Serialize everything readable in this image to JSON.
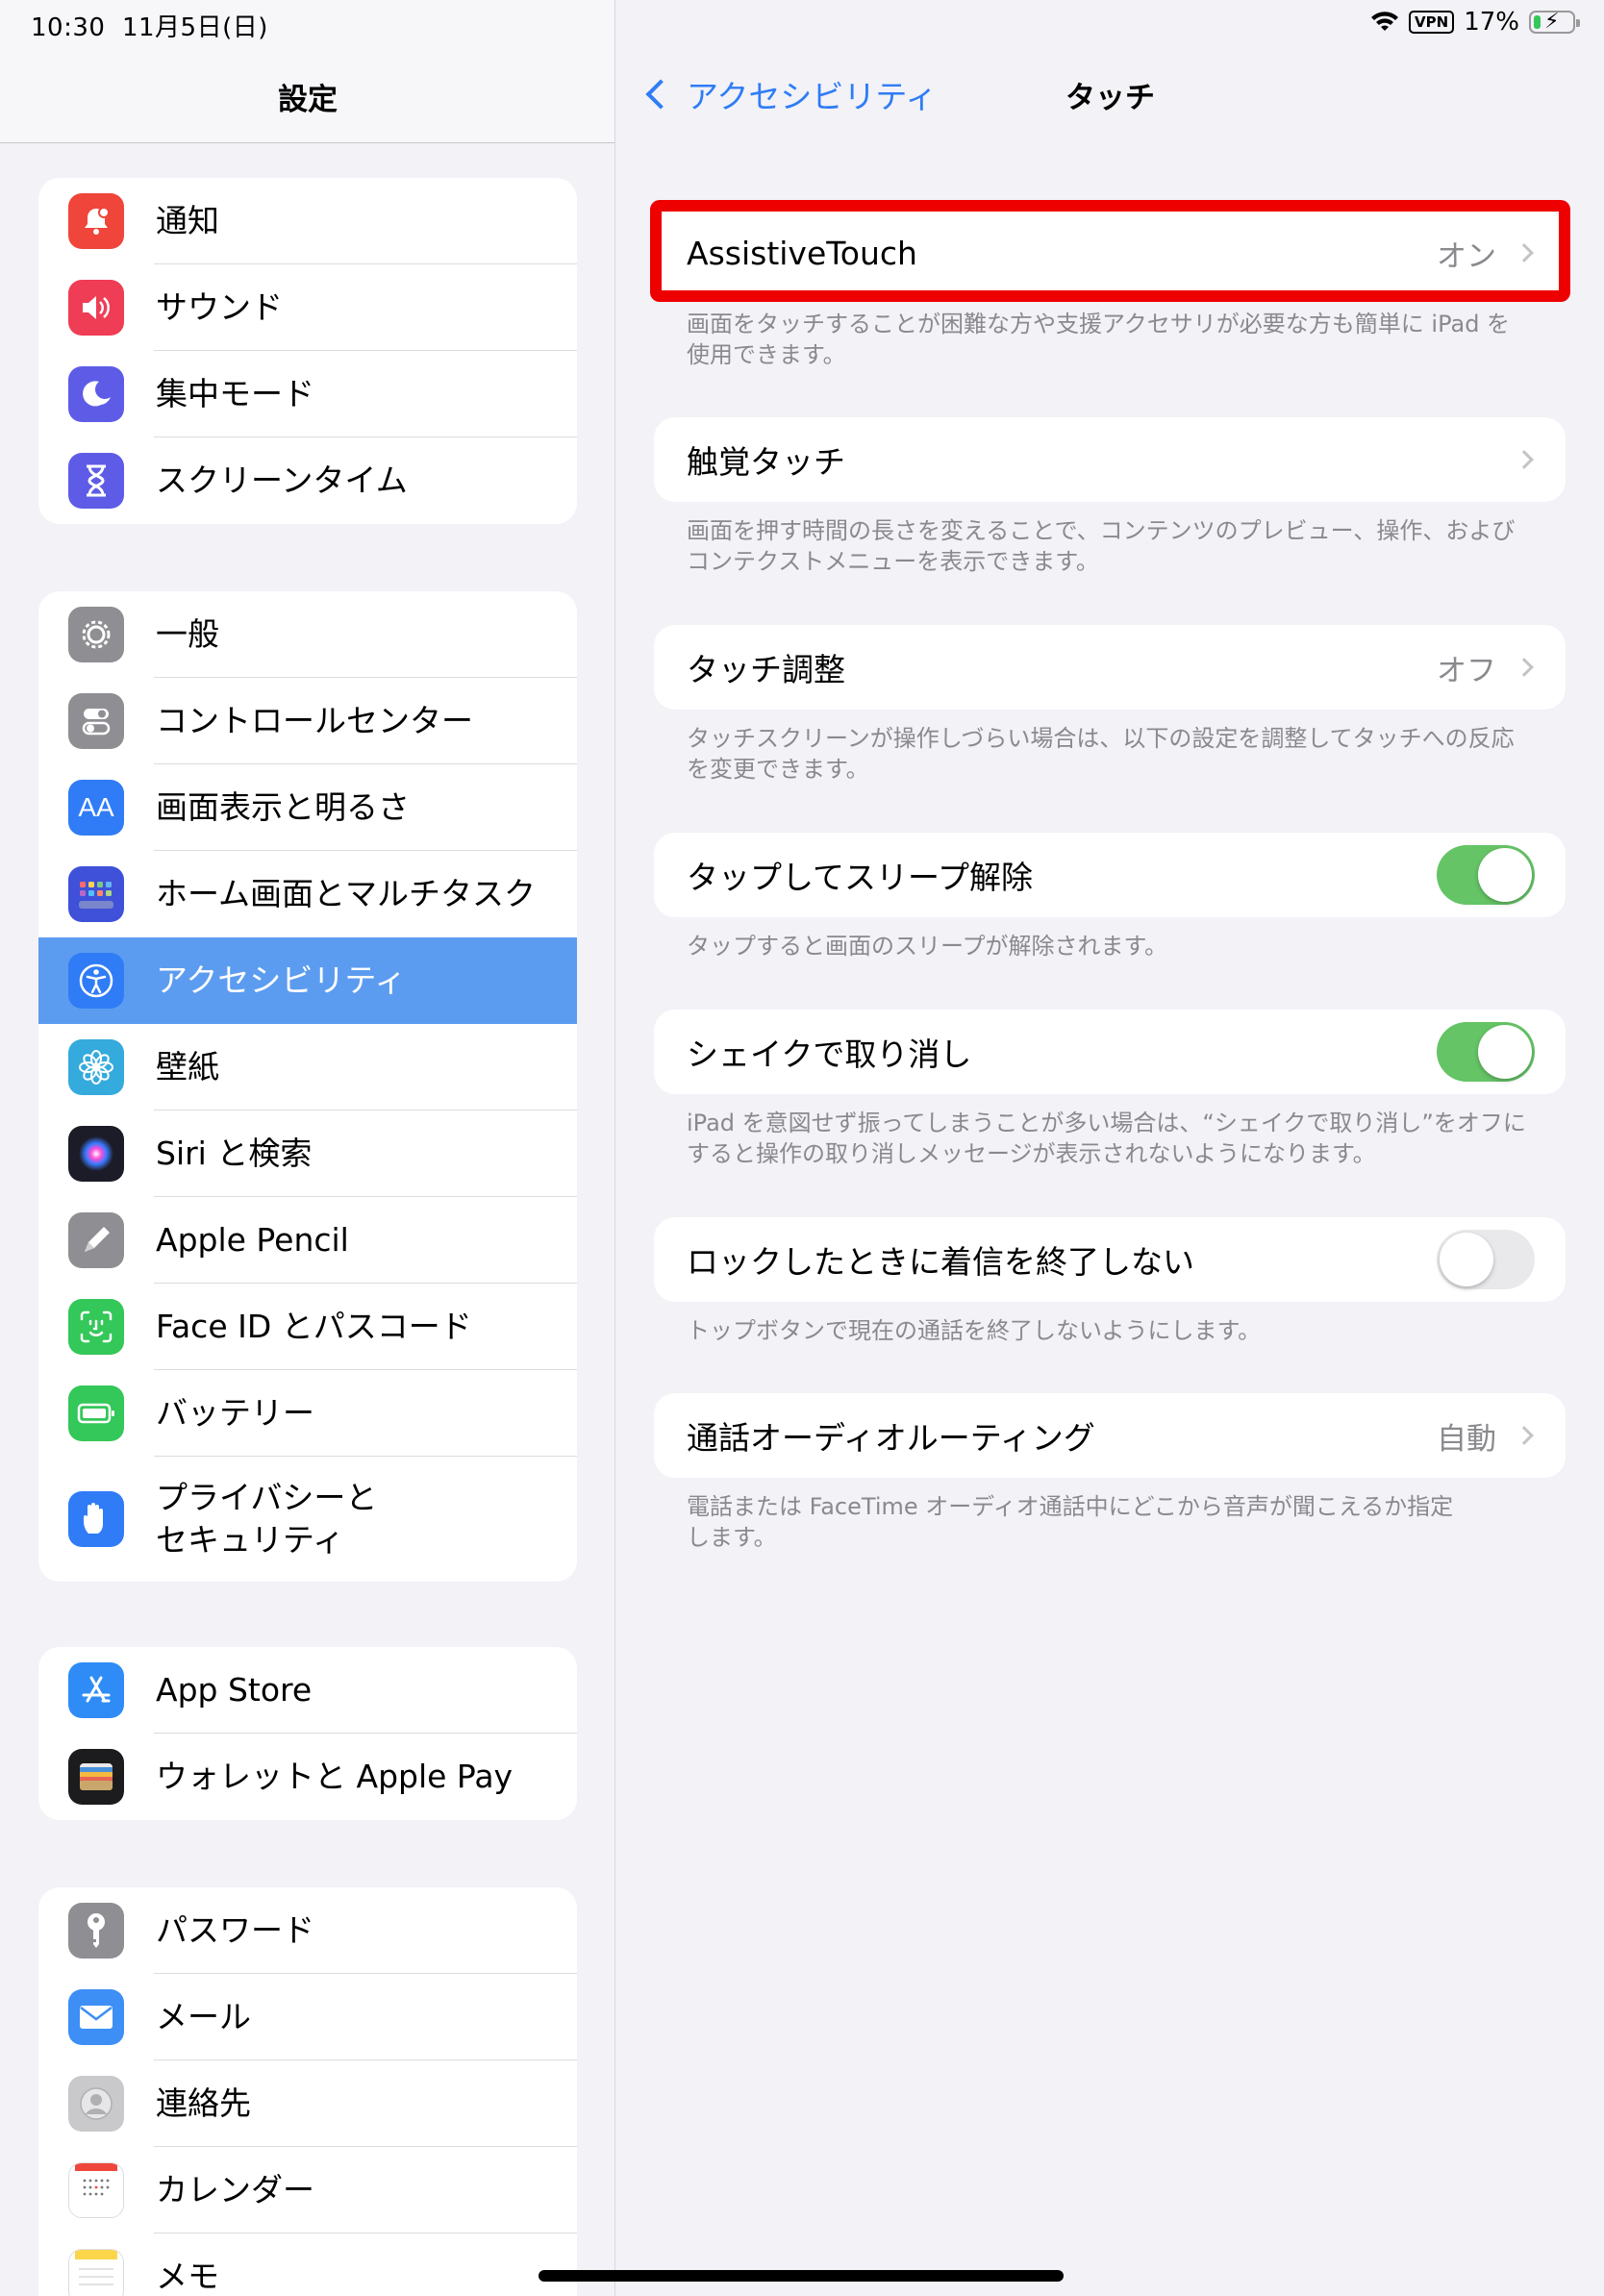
{
  "status": {
    "time": "10:30",
    "date": "11月5日(日)",
    "vpn": "VPN",
    "battery": "17%",
    "battery_level": 0.17
  },
  "sidebar": {
    "title": "設定",
    "groups": [
      [
        {
          "label": "通知",
          "icon": "bell-icon",
          "color": "#f0453a"
        },
        {
          "label": "サウンド",
          "icon": "speaker-icon",
          "color": "#ef3d55"
        },
        {
          "label": "集中モード",
          "icon": "moon-icon",
          "color": "#5e5ce6"
        },
        {
          "label": "スクリーンタイム",
          "icon": "hourglass-icon",
          "color": "#5e5ce6"
        }
      ],
      [
        {
          "label": "一般",
          "icon": "gear-icon",
          "color": "#8e8e93"
        },
        {
          "label": "コントロールセンター",
          "icon": "switches-icon",
          "color": "#8e8e93"
        },
        {
          "label": "画面表示と明るさ",
          "icon": "text-size-icon",
          "color": "#2f7cf6"
        },
        {
          "label": "ホーム画面とマルチタスク",
          "icon": "home-grid-icon",
          "color": "#3f51d8"
        },
        {
          "label": "アクセシビリティ",
          "icon": "accessibility-icon",
          "color": "#2f7cf6",
          "selected": true
        },
        {
          "label": "壁紙",
          "icon": "flower-icon",
          "color": "#35aadc"
        },
        {
          "label": "Siri と検索",
          "icon": "siri-icon",
          "color": "#1c1c28"
        },
        {
          "label": "Apple Pencil",
          "icon": "pencil-icon",
          "color": "#8e8e93"
        },
        {
          "label": "Face ID とパスコード",
          "icon": "face-id-icon",
          "color": "#34c759"
        },
        {
          "label": "バッテリー",
          "icon": "battery-icon",
          "color": "#34c759"
        },
        {
          "label": "プライバシーと\nセキュリティ",
          "icon": "hand-icon",
          "color": "#2f7cf6"
        }
      ],
      [
        {
          "label": "App Store",
          "icon": "app-store-icon",
          "color": "#2f8cf6"
        },
        {
          "label": "ウォレットと Apple Pay",
          "icon": "wallet-icon",
          "color": "#1c1c1e"
        }
      ],
      [
        {
          "label": "パスワード",
          "icon": "key-icon",
          "color": "#8e8e93"
        },
        {
          "label": "メール",
          "icon": "mail-icon",
          "color": "#3d8ff5"
        },
        {
          "label": "連絡先",
          "icon": "contacts-icon",
          "color": "#c9c9cc"
        },
        {
          "label": "カレンダー",
          "icon": "calendar-icon",
          "color": "#ffffff"
        },
        {
          "label": "メモ",
          "icon": "notes-icon",
          "color": "#ffffff"
        }
      ]
    ]
  },
  "detail": {
    "back_label": "アクセシビリティ",
    "title": "タッチ",
    "items": [
      {
        "label": "AssistiveTouch",
        "value": "オン",
        "type": "link",
        "footnote": "画面をタッチすることが困難な方や支援アクセサリが必要な方も簡単に iPad を\n使用できます。"
      },
      {
        "label": "触覚タッチ",
        "value": "",
        "type": "link",
        "footnote": "画面を押す時間の長さを変えることで、コンテンツのプレビュー、操作、および\nコンテクストメニューを表示できます。"
      },
      {
        "label": "タッチ調整",
        "value": "オフ",
        "type": "link",
        "footnote": "タッチスクリーンが操作しづらい場合は、以下の設定を調整してタッチへの反応\nを変更できます。"
      },
      {
        "label": "タップしてスリープ解除",
        "type": "toggle",
        "on": true,
        "footnote": "タップすると画面のスリープが解除されます。"
      },
      {
        "label": "シェイクで取り消し",
        "type": "toggle",
        "on": true,
        "footnote": "iPad を意図せず振ってしまうことが多い場合は、“シェイクで取り消し”をオフに\nすると操作の取り消しメッセージが表示されないようになります。"
      },
      {
        "label": "ロックしたときに着信を終了しない",
        "type": "toggle",
        "on": false,
        "footnote": "トップボタンで現在の通話を終了しないようにします。"
      },
      {
        "label": "通話オーディオルーティング",
        "value": "自動",
        "type": "link",
        "footnote": "電話または FaceTime オーディオ通話中にどこから音声が聞こえるか指定\nします。"
      }
    ]
  },
  "colors": {
    "accent": "#2f7cf6",
    "selected_row": "#5c9cf0",
    "toggle_on": "#65c466",
    "highlight": "#ee0000"
  }
}
